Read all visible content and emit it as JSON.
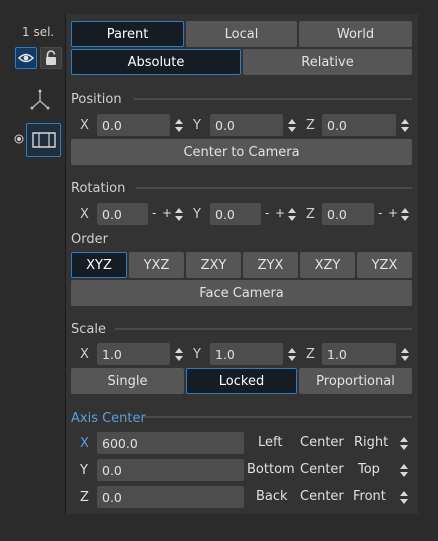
{
  "left_rail": {
    "selection_count": "1 sel.",
    "icons": [
      "eye-icon",
      "lock-icon",
      "axes-icon",
      "radio-icon",
      "frame-icon"
    ]
  },
  "reference_tabs": [
    {
      "label": "Parent",
      "active": true
    },
    {
      "label": "Local",
      "active": false
    },
    {
      "label": "World",
      "active": false
    }
  ],
  "mode_tabs": [
    {
      "label": "Absolute",
      "active": true
    },
    {
      "label": "Relative",
      "active": false
    }
  ],
  "position": {
    "title": "Position",
    "x": {
      "label": "X",
      "value": "0.0"
    },
    "y": {
      "label": "Y",
      "value": "0.0"
    },
    "z": {
      "label": "Z",
      "value": "0.0"
    },
    "center_button": "Center to Camera"
  },
  "rotation": {
    "title": "Rotation",
    "x": {
      "label": "X",
      "value": "0.0"
    },
    "y": {
      "label": "Y",
      "value": "0.0"
    },
    "z": {
      "label": "Z",
      "value": "0.0"
    },
    "minus": "-",
    "plus": "+"
  },
  "order": {
    "title": "Order",
    "options": [
      {
        "label": "XYZ",
        "active": true
      },
      {
        "label": "YXZ",
        "active": false
      },
      {
        "label": "ZXY",
        "active": false
      },
      {
        "label": "ZYX",
        "active": false
      },
      {
        "label": "XZY",
        "active": false
      },
      {
        "label": "YZX",
        "active": false
      }
    ],
    "face_camera": "Face Camera"
  },
  "scale": {
    "title": "Scale",
    "x": {
      "label": "X",
      "value": "1.0"
    },
    "y": {
      "label": "Y",
      "value": "1.0"
    },
    "z": {
      "label": "Z",
      "value": "1.0"
    },
    "modes": [
      {
        "label": "Single",
        "active": false
      },
      {
        "label": "Locked",
        "active": true
      },
      {
        "label": "Proportional",
        "active": false
      }
    ]
  },
  "axis_center": {
    "title": "Axis Center",
    "rows": [
      {
        "axis": "X",
        "value": "600.0",
        "a": "Left",
        "b": "Center",
        "c": "Right"
      },
      {
        "axis": "Y",
        "value": "0.0",
        "a": "Bottom",
        "b": "Center",
        "c": "Top"
      },
      {
        "axis": "Z",
        "value": "0.0",
        "a": "Back",
        "b": "Center",
        "c": "Front"
      }
    ]
  },
  "colors": {
    "accent": "#2f7cc4",
    "axis_center_title": "#5a9fe0",
    "panel_bg": "#333333",
    "button_bg": "#565656",
    "field_bg": "#4d4d4d"
  }
}
